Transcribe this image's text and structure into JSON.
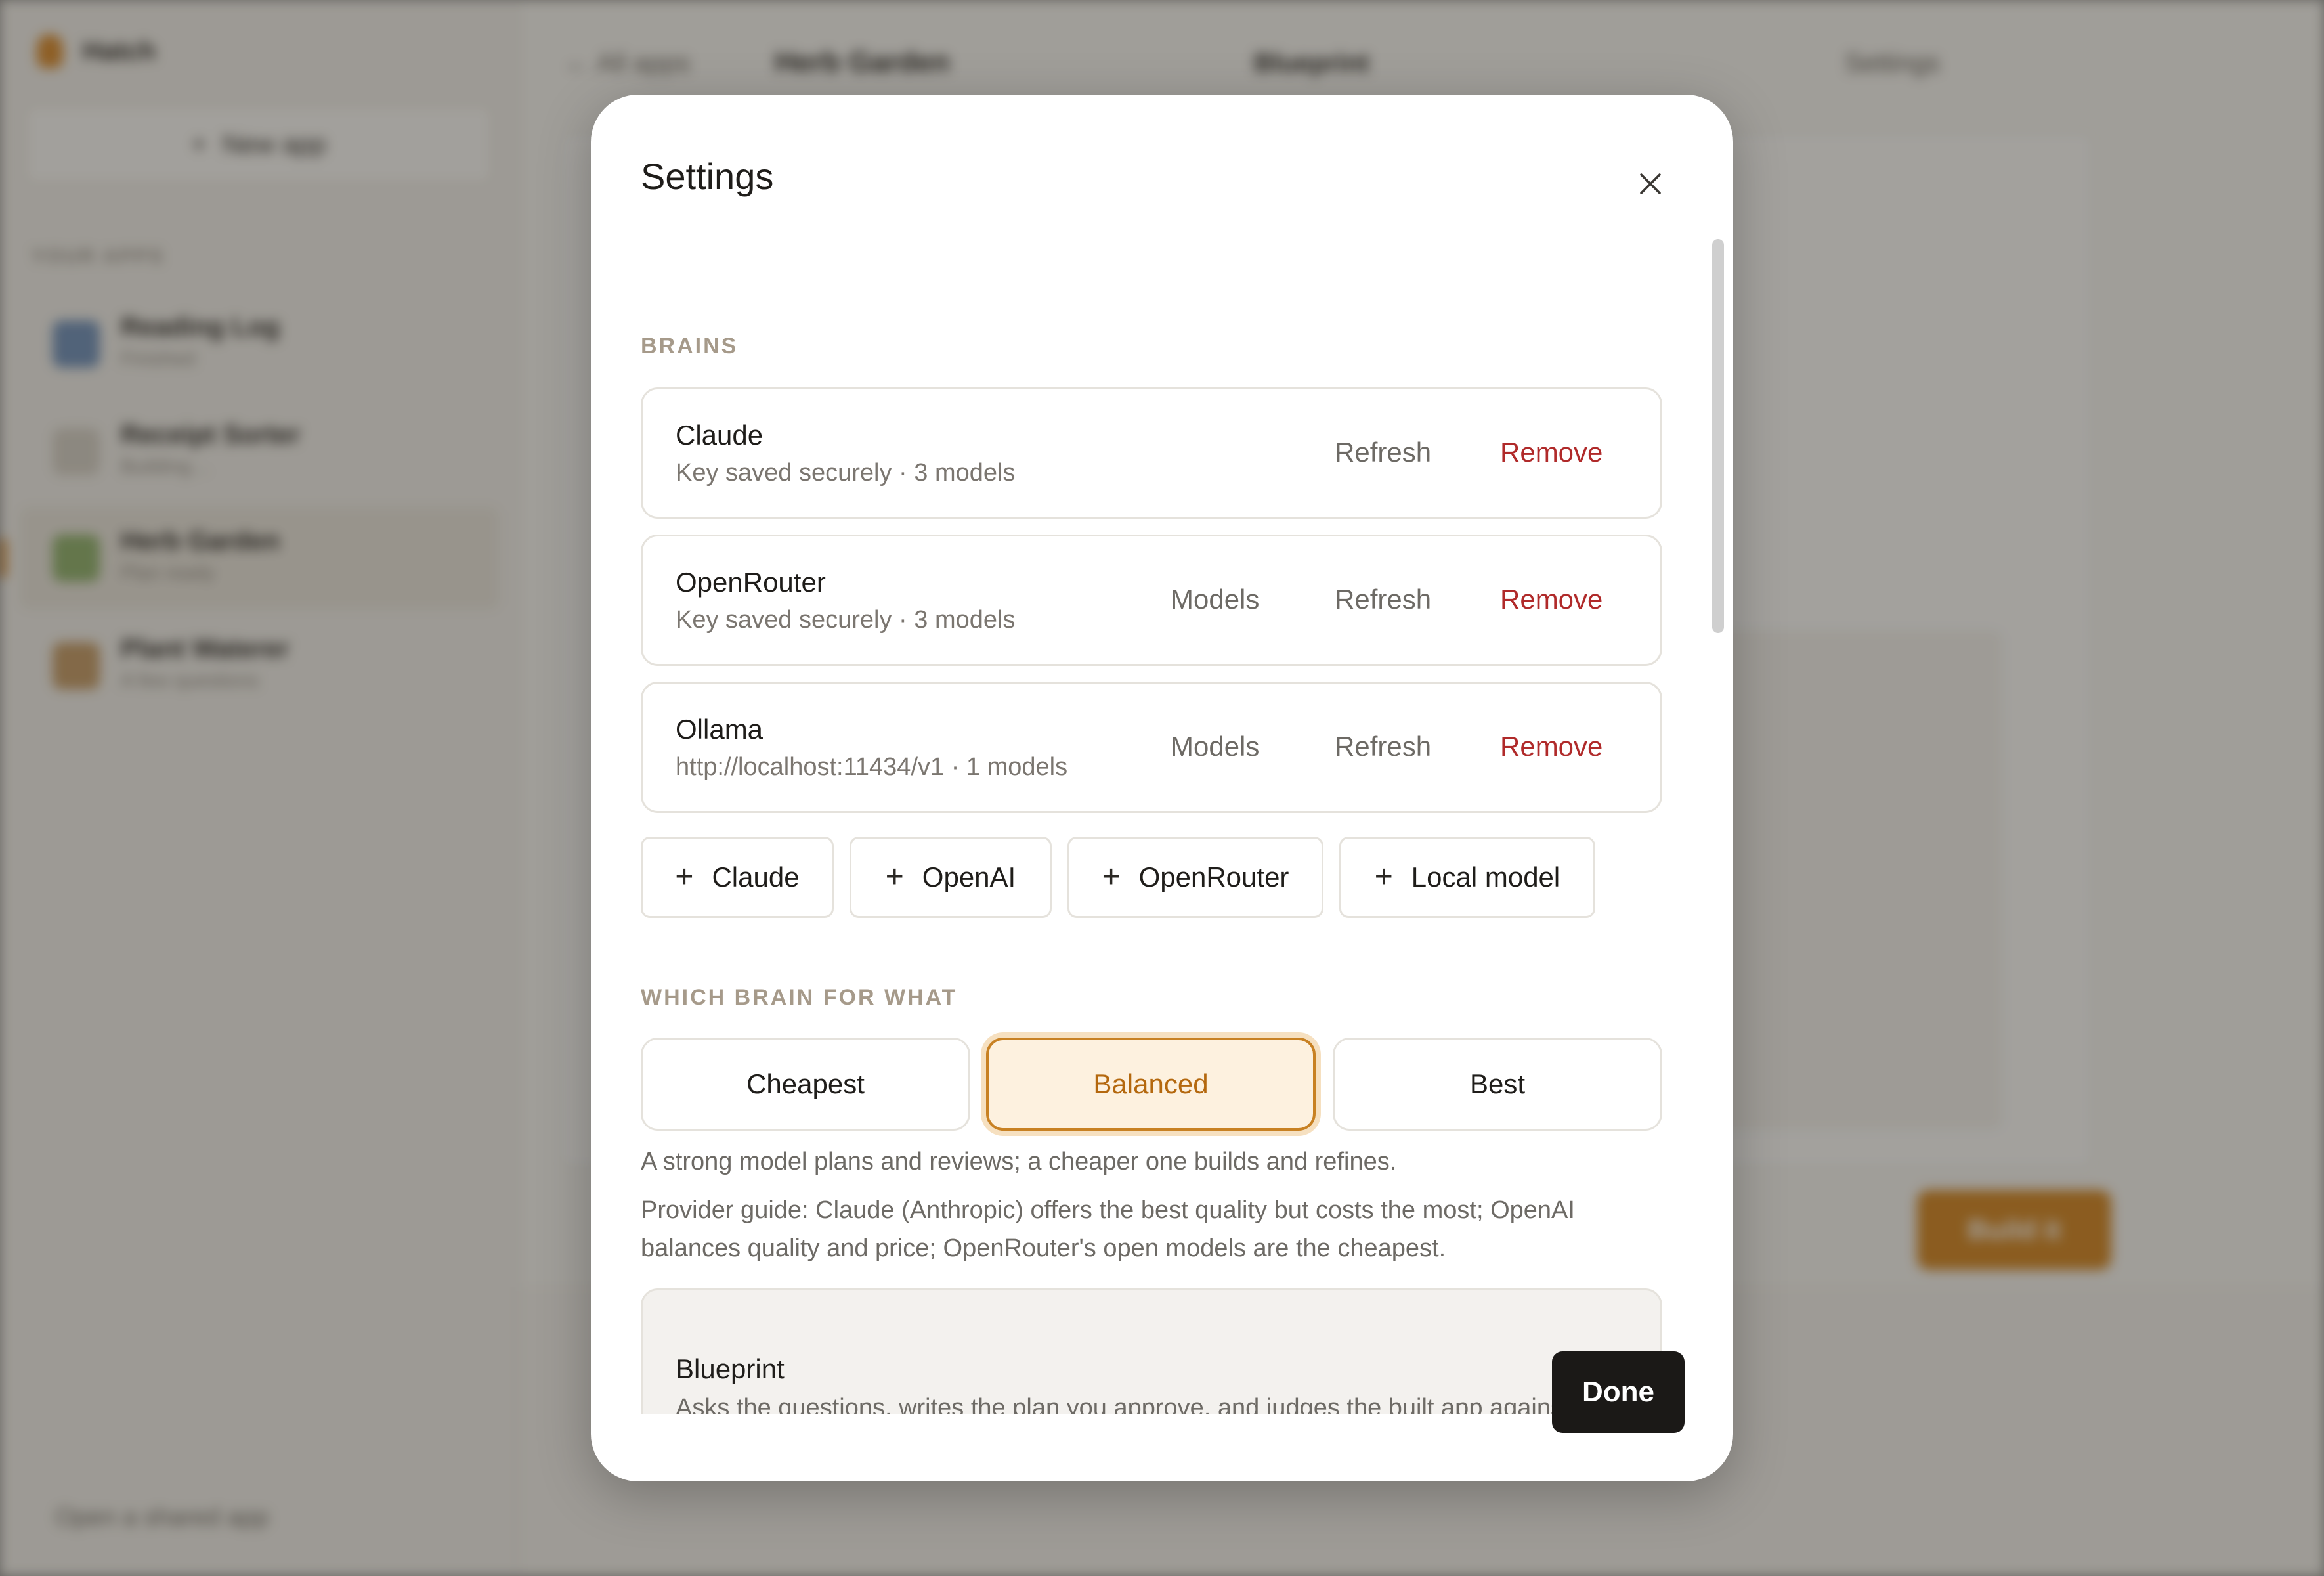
{
  "background": {
    "brand": "Hatch",
    "new_app_label": "New app",
    "your_apps_label": "YOUR APPS",
    "apps": [
      {
        "name": "Reading Log",
        "status": "Finished"
      },
      {
        "name": "Receipt Sorter",
        "status": "Building…"
      },
      {
        "name": "Herb Garden",
        "status": "Plan ready"
      },
      {
        "name": "Plant Waterer",
        "status": "A few questions"
      }
    ],
    "open_shared_label": "Open a shared app",
    "back_label": "All apps",
    "current_app": "Herb Garden",
    "stage_label": "Blueprint",
    "settings_label": "Settings",
    "build_label": "Build it"
  },
  "modal": {
    "title": "Settings",
    "brains_label": "BRAINS",
    "providers": [
      {
        "name": "Claude",
        "meta": "Key saved securely · 3 models",
        "models_label": "",
        "refresh_label": "Refresh",
        "remove_label": "Remove"
      },
      {
        "name": "OpenRouter",
        "meta": "Key saved securely · 3 models",
        "models_label": "Models",
        "refresh_label": "Refresh",
        "remove_label": "Remove"
      },
      {
        "name": "Ollama",
        "meta": "http://localhost:11434/v1 · 1 models",
        "models_label": "Models",
        "refresh_label": "Refresh",
        "remove_label": "Remove"
      }
    ],
    "add_buttons": [
      "Claude",
      "OpenAI",
      "OpenRouter",
      "Local model"
    ],
    "which_brain_label": "WHICH BRAIN FOR WHAT",
    "modes": [
      "Cheapest",
      "Balanced",
      "Best"
    ],
    "selected_mode": "Balanced",
    "mode_help": "A strong model plans and reviews; a cheaper one builds and refines.",
    "provider_guide": "Provider guide: Claude (Anthropic) offers the best quality but costs the most; OpenAI balances quality and price; OpenRouter's open models are the cheapest.",
    "role": {
      "title": "Blueprint",
      "description": "Asks the questions, writes the plan you approve, and judges the built app against it —"
    },
    "done_label": "Done"
  },
  "colors": {
    "accent": "#c88123",
    "danger": "#b02a2a",
    "done_button": "#1b1917"
  }
}
